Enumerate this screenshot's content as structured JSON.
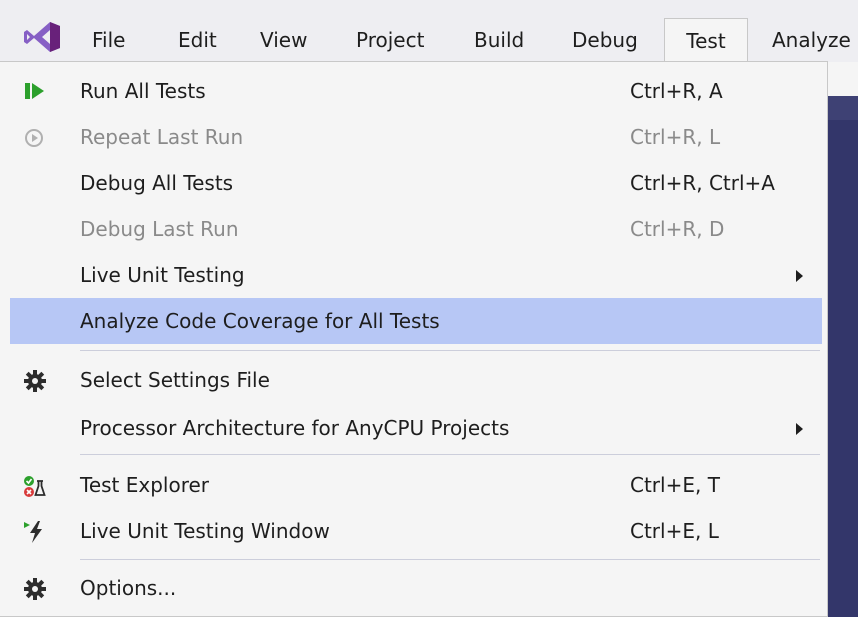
{
  "menubar": {
    "items": [
      {
        "label": "File"
      },
      {
        "label": "Edit"
      },
      {
        "label": "View"
      },
      {
        "label": "Project"
      },
      {
        "label": "Build"
      },
      {
        "label": "Debug"
      },
      {
        "label": "Test",
        "active": true
      },
      {
        "label": "Analyze"
      }
    ]
  },
  "menu": {
    "items": [
      {
        "label": "Run All Tests",
        "shortcut": "Ctrl+R, A",
        "icon": "run-all-tests-icon"
      },
      {
        "label": "Repeat Last Run",
        "shortcut": "Ctrl+R, L",
        "icon": "repeat-last-run-icon",
        "disabled": true
      },
      {
        "label": "Debug All Tests",
        "shortcut": "Ctrl+R, Ctrl+A"
      },
      {
        "label": "Debug Last Run",
        "shortcut": "Ctrl+R, D",
        "disabled": true
      },
      {
        "label": "Live Unit Testing",
        "submenu": true
      },
      {
        "label": "Analyze Code Coverage for All Tests",
        "highlighted": true
      },
      {
        "label": "Select Settings File",
        "icon": "gear-icon"
      },
      {
        "label": "Processor Architecture for AnyCPU Projects",
        "submenu": true
      },
      {
        "label": "Test Explorer",
        "shortcut": "Ctrl+E, T",
        "icon": "test-explorer-icon"
      },
      {
        "label": "Live Unit Testing Window",
        "shortcut": "Ctrl+E, L",
        "icon": "live-unit-testing-icon"
      },
      {
        "label": "Options...",
        "icon": "gear-icon"
      }
    ]
  },
  "colors": {
    "highlight": "#b7c7f5",
    "menu_background": "#f5f5f5",
    "run_icon_green": "#2ca02c",
    "logo_purple": "#865fc5",
    "editor_background": "#33366a"
  }
}
